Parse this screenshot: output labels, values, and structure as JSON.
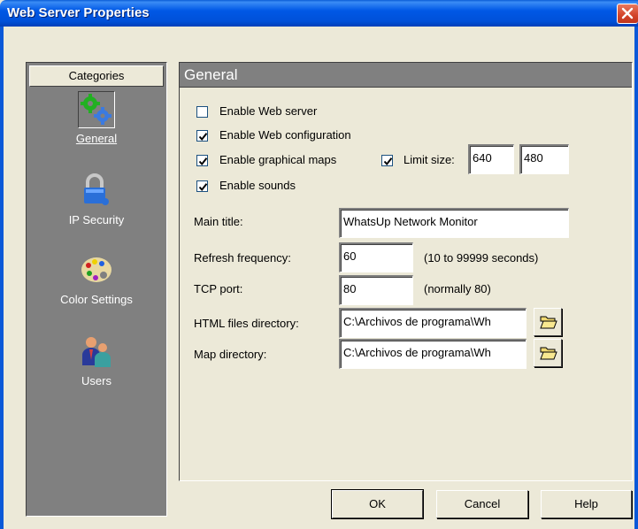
{
  "window": {
    "title": "Web Server Properties"
  },
  "sidebar": {
    "header": "Categories",
    "items": [
      {
        "label": "General",
        "icon": "gears-icon",
        "selected": true
      },
      {
        "label": "IP Security",
        "icon": "padlock-icon",
        "selected": false
      },
      {
        "label": "Color Settings",
        "icon": "palette-icon",
        "selected": false
      },
      {
        "label": "Users",
        "icon": "users-icon",
        "selected": false
      }
    ]
  },
  "panel": {
    "title": "General",
    "checkboxes": {
      "enable_web_server": {
        "label": "Enable Web server",
        "checked": false
      },
      "enable_web_configuration": {
        "label": "Enable Web configuration",
        "checked": true
      },
      "enable_graphical_maps": {
        "label": "Enable graphical maps",
        "checked": true
      },
      "limit_size": {
        "label": "Limit size:",
        "checked": true
      },
      "enable_sounds": {
        "label": "Enable sounds",
        "checked": true
      }
    },
    "limit_width": "640",
    "limit_height": "480",
    "main_title": {
      "label": "Main title:",
      "value": "WhatsUp Network Monitor"
    },
    "refresh_frequency": {
      "label": "Refresh frequency:",
      "value": "60",
      "hint": "(10 to 99999 seconds)"
    },
    "tcp_port": {
      "label": "TCP port:",
      "value": "80",
      "hint": "(normally 80)"
    },
    "html_dir": {
      "label": "HTML files directory:",
      "value": "C:\\Archivos de programa\\Wh"
    },
    "map_dir": {
      "label": "Map directory:",
      "value": "C:\\Archivos de programa\\Wh"
    }
  },
  "buttons": {
    "ok": "OK",
    "cancel": "Cancel",
    "help": "Help"
  },
  "colors": {
    "titlebar": "#0058e6",
    "sidebar": "#808080",
    "face": "#ece9d8",
    "close": "#d2432a"
  }
}
